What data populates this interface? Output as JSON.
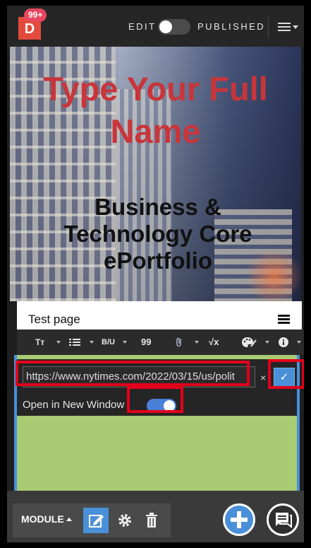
{
  "topbar": {
    "logo_letter": "D",
    "badge_count": "99+",
    "edit_label": "EDIT",
    "published_label": "PUBLISHED",
    "toggle_on": false
  },
  "hero": {
    "name": "Type Your Full Name",
    "subtitle": "Business & Technology Core ePortfolio"
  },
  "page": {
    "title": "Test page"
  },
  "toolbar": {
    "text_size": "Tт",
    "bold_italic_underline": "B/U",
    "quote": "99",
    "formula": "√x"
  },
  "link_editor": {
    "url": "https://www.nytimes.com/2022/03/15/us/polit",
    "clear_symbol": "×",
    "confirm_symbol": "✓",
    "new_window_label": "Open in New Window",
    "new_window_on": true
  },
  "bottom": {
    "module_label": "MODULE"
  },
  "colors": {
    "accent": "#4a90d9",
    "brand": "#e24b3b",
    "highlight": "#e3001b",
    "module_bg": "#a9cb73"
  }
}
